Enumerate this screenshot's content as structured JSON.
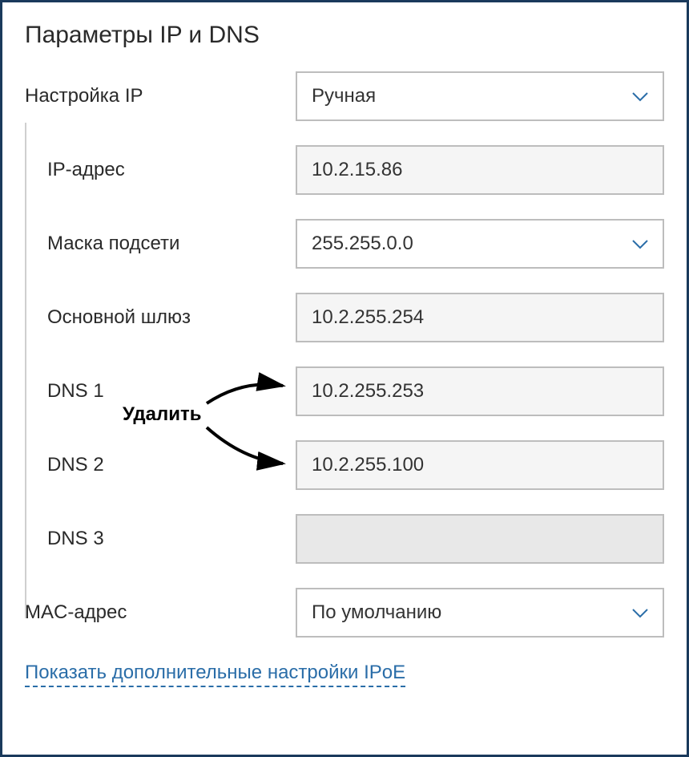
{
  "section_title": "Параметры IP и DNS",
  "ip_config": {
    "label": "Настройка IP",
    "value": "Ручная"
  },
  "fields": {
    "ip_address": {
      "label": "IP-адрес",
      "value": "10.2.15.86"
    },
    "subnet_mask": {
      "label": "Маска подсети",
      "value": "255.255.0.0"
    },
    "gateway": {
      "label": "Основной шлюз",
      "value": "10.2.255.254"
    },
    "dns1": {
      "label": "DNS 1",
      "value": "10.2.255.253"
    },
    "dns2": {
      "label": "DNS 2",
      "value": "10.2.255.100"
    },
    "dns3": {
      "label": "DNS 3",
      "value": ""
    }
  },
  "mac_address": {
    "label": "MAC-адрес",
    "value": "По умолчанию"
  },
  "show_more_link": "Показать дополнительные настройки IPoE",
  "annotation": {
    "label": "Удалить"
  }
}
